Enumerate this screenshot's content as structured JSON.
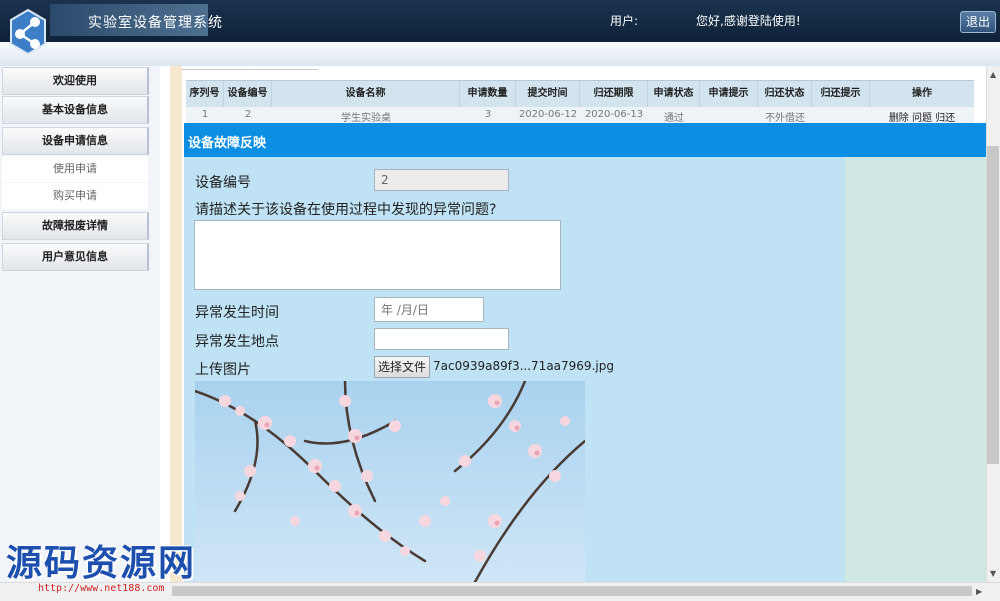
{
  "header": {
    "app_title": "实验室设备管理系统",
    "user_label": "用户:",
    "user_name": "",
    "welcome": "您好,感谢登陆使用!",
    "logout_label": "退出"
  },
  "sidebar": {
    "items": [
      {
        "label": "欢迎使用"
      },
      {
        "label": "基本设备信息"
      },
      {
        "label": "设备申请信息"
      },
      {
        "label": "使用申请"
      },
      {
        "label": "购买申请"
      },
      {
        "label": "故障报废详情"
      },
      {
        "label": "用户意见信息"
      }
    ]
  },
  "table": {
    "columns": [
      "序列号",
      "设备编号",
      "设备名称",
      "申请数量",
      "提交时间",
      "归还期限",
      "申请状态",
      "申请提示",
      "归还状态",
      "归还提示",
      "操作"
    ],
    "row": [
      "1",
      "2",
      "学生实验桌",
      "3",
      "2020-06-12",
      "2020-06-13",
      "通过",
      "",
      "不外借还",
      "",
      "删除 问题 归还"
    ]
  },
  "modal": {
    "title": "设备故障反映",
    "device_no_label": "设备编号",
    "device_no_value": "2",
    "question_label": "请描述关于该设备在使用过程中发现的异常问题?",
    "description_value": "",
    "time_label": "异常发生时间",
    "date_placeholder": "年 /月/日",
    "location_label": "异常发生地点",
    "location_value": "",
    "upload_label": "上传图片",
    "file_button_label": "选择文件",
    "file_name": "7ac0939a89f3...71aa7969.jpg"
  },
  "watermark": {
    "text": "源码资源网",
    "url": "http://www.net188.com"
  },
  "colors": {
    "header_bg": "#0e2238",
    "modal_header": "#0c8fe2",
    "modal_body": "#bfe2f5",
    "table_head": "#d2e4ee"
  },
  "icons": {
    "logo": "share-network-icon"
  }
}
